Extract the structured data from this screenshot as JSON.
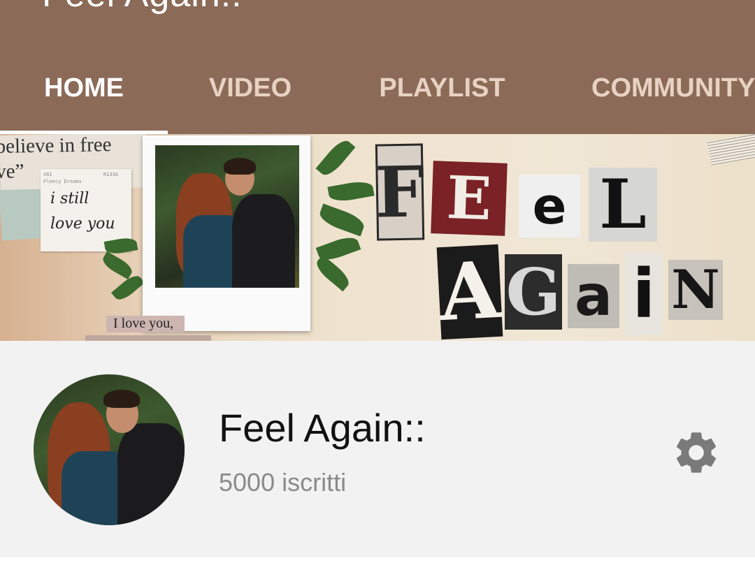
{
  "header": {
    "title_cropped": "Feel Again::"
  },
  "tabs": [
    {
      "label": "HOME",
      "active": true
    },
    {
      "label": "VIDEO",
      "active": false
    },
    {
      "label": "PLAYLIST",
      "active": false
    },
    {
      "label": "COMMUNITY",
      "active": false
    }
  ],
  "banner": {
    "quote_line1": "believe in free",
    "quote_line2": "ve”",
    "note_tiny_left": "X61",
    "note_tiny_right": "R133A",
    "note_tiny_sub": "Fleecy Dreams",
    "note_line1": "i still",
    "note_line2": "love you",
    "love_strip": "I love you,",
    "art_title_word1": "FEEL",
    "art_title_word2": "AGAIN"
  },
  "channel": {
    "name": "Feel Again::",
    "subscribers": "5000 iscritti",
    "settings_icon": "gear-icon"
  },
  "colors": {
    "header_bg": "#8b6a58",
    "tab_inactive": "#e8d2c2",
    "tab_active": "#ffffff",
    "channel_bg": "#f2f2f2",
    "gear": "#7a7a7a"
  }
}
